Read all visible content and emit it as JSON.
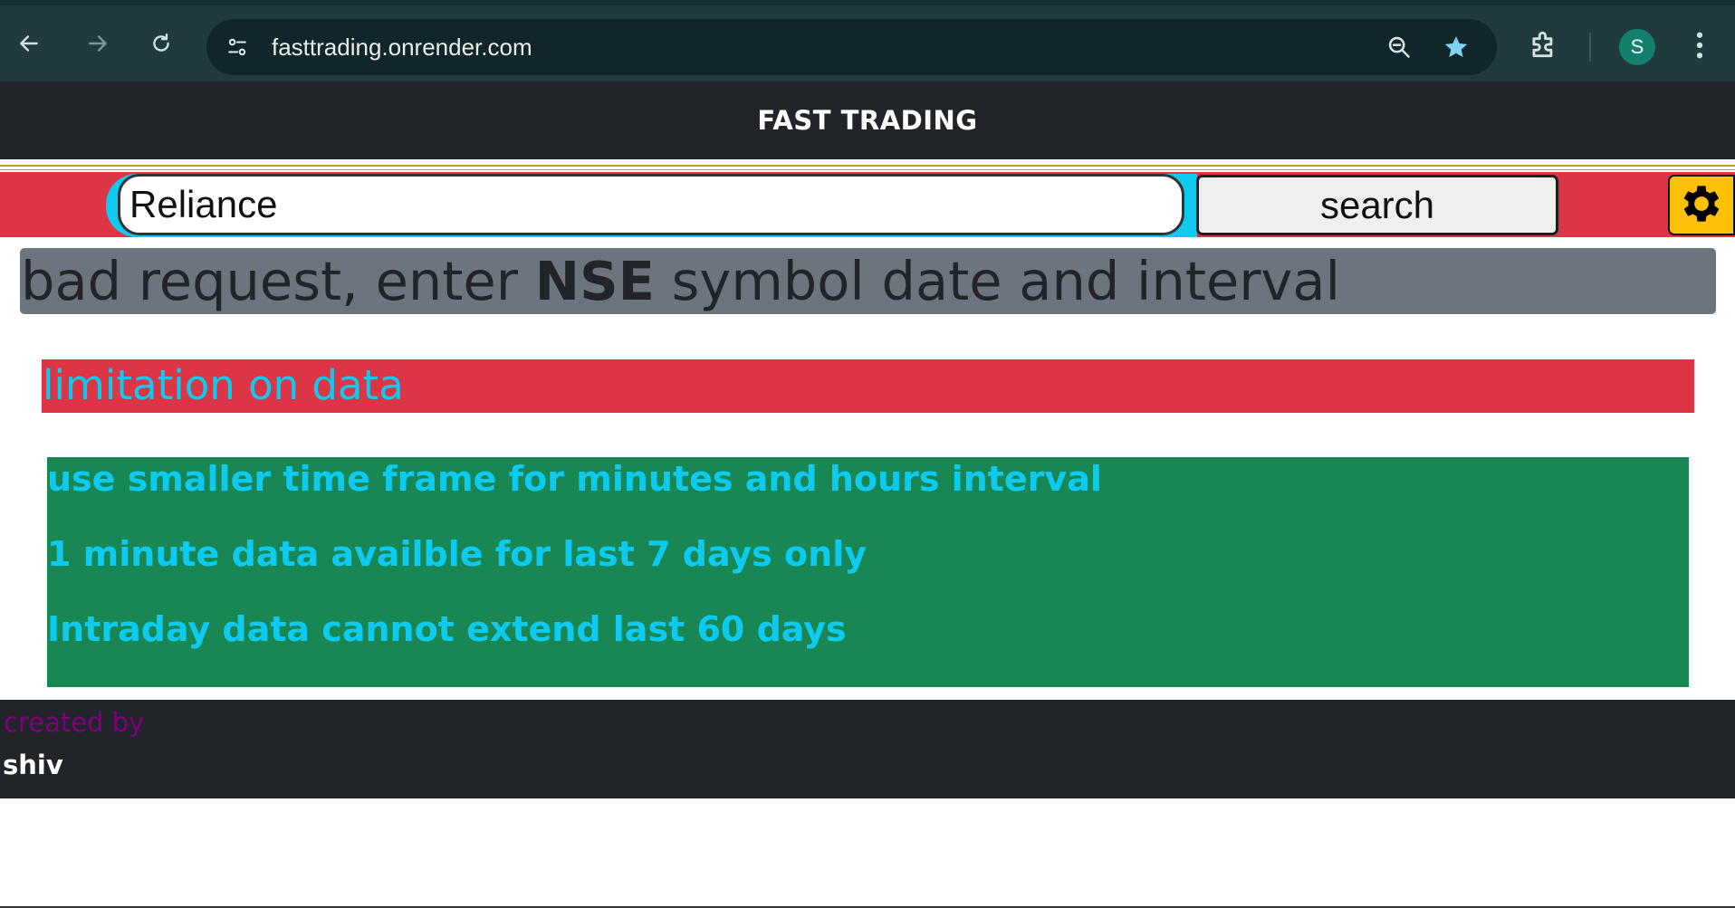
{
  "browser": {
    "url": "fasttrading.onrender.com",
    "profile_initial": "S",
    "icons": [
      "back-arrow-icon",
      "forward-arrow-icon",
      "reload-icon",
      "site-settings-icon",
      "zoom-icon",
      "star-icon",
      "extensions-icon",
      "menu-icon"
    ]
  },
  "header": {
    "brand": "FAST TRADING"
  },
  "search": {
    "value": "Reliance",
    "button_label": "search",
    "settings_icon": "gear-icon"
  },
  "alert": {
    "before": "bad request, enter ",
    "bold": "NSE",
    "after": " symbol date and interval"
  },
  "limitation": {
    "title": "limitation on data"
  },
  "info": {
    "lines": [
      "use smaller time frame for minutes and hours interval",
      "1 minute data availble for last 7 days only",
      "Intraday data cannot extend last 60 days"
    ]
  },
  "footer": {
    "created_label": "created by",
    "author": "shiv"
  },
  "colors": {
    "navbar": "#212529",
    "danger": "#dc3545",
    "info": "#0dcaf0",
    "success": "#198754",
    "secondary": "#6c757d",
    "warning": "#ffc107",
    "purple": "#800080"
  }
}
